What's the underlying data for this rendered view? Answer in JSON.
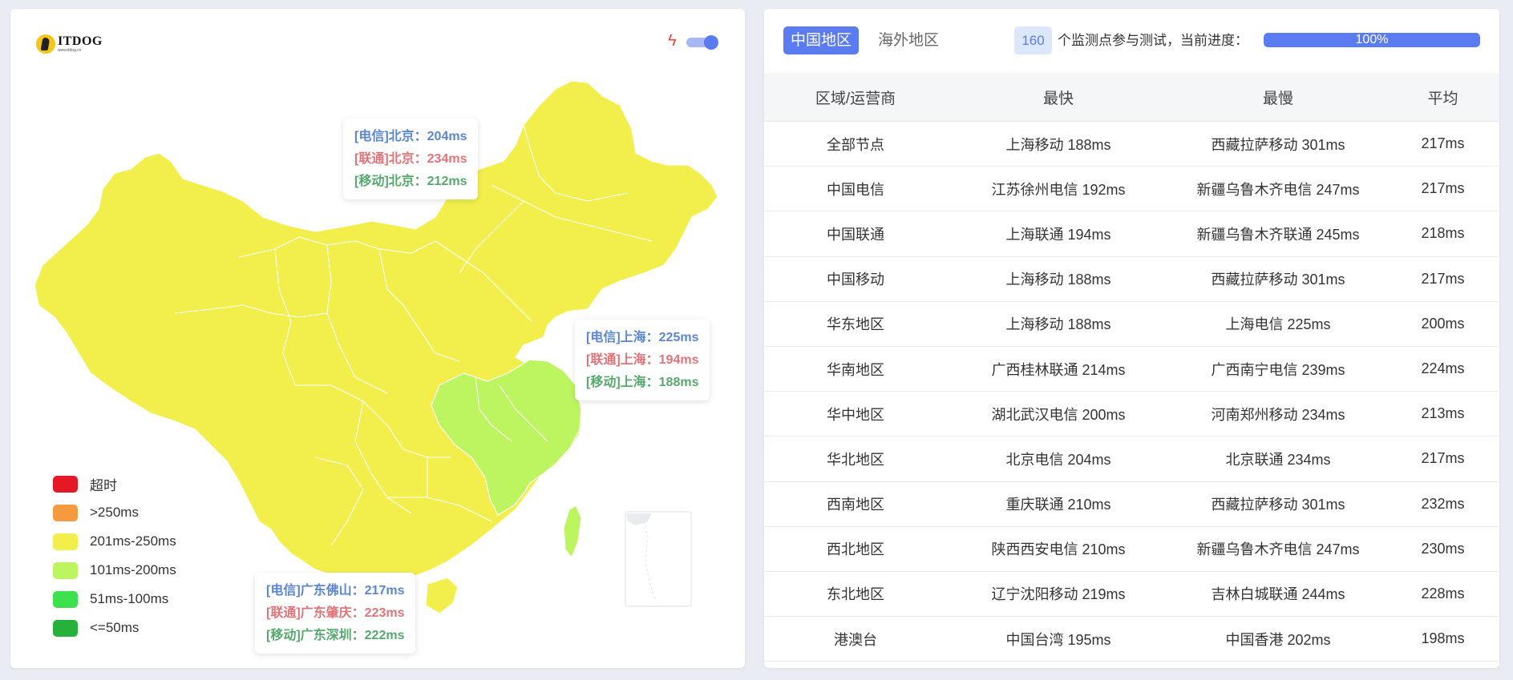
{
  "brand": {
    "title": "ITDOG",
    "subtitle": "www.itdog.cn"
  },
  "map": {
    "tooltips": {
      "beijing": [
        "[电信]北京：204ms",
        "[联通]北京：234ms",
        "[移动]北京：212ms"
      ],
      "shanghai": [
        "[电信]上海：225ms",
        "[联通]上海：194ms",
        "[移动]上海：188ms"
      ],
      "guangdong": [
        "[电信]广东佛山：217ms",
        "[联通]广东肇庆：223ms",
        "[移动]广东深圳：222ms"
      ]
    },
    "colors": {
      "range_201_250": "#f2ef4d",
      "range_101_200": "#bdf561"
    }
  },
  "legend": [
    {
      "label": "超时",
      "color": "#e51827"
    },
    {
      "label": ">250ms",
      "color": "#f49b3f"
    },
    {
      "label": "201ms-250ms",
      "color": "#f2ef4d"
    },
    {
      "label": "101ms-200ms",
      "color": "#bdf561"
    },
    {
      "label": "51ms-100ms",
      "color": "#3de04d"
    },
    {
      "label": "<=50ms",
      "color": "#26b13a"
    }
  ],
  "tabs": {
    "active": "中国地区",
    "inactive": "海外地区"
  },
  "status": {
    "count": "160",
    "text": "个监测点参与测试，当前进度：",
    "progress": "100%",
    "progress_fraction": 1.0
  },
  "table": {
    "headers": [
      "区域/运营商",
      "最快",
      "最慢",
      "平均"
    ],
    "rows": [
      [
        "全部节点",
        "上海移动 188ms",
        "西藏拉萨移动 301ms",
        "217ms"
      ],
      [
        "中国电信",
        "江苏徐州电信 192ms",
        "新疆乌鲁木齐电信 247ms",
        "217ms"
      ],
      [
        "中国联通",
        "上海联通 194ms",
        "新疆乌鲁木齐联通 245ms",
        "218ms"
      ],
      [
        "中国移动",
        "上海移动 188ms",
        "西藏拉萨移动 301ms",
        "217ms"
      ],
      [
        "华东地区",
        "上海移动 188ms",
        "上海电信 225ms",
        "200ms"
      ],
      [
        "华南地区",
        "广西桂林联通 214ms",
        "广西南宁电信 239ms",
        "224ms"
      ],
      [
        "华中地区",
        "湖北武汉电信 200ms",
        "河南郑州移动 234ms",
        "213ms"
      ],
      [
        "华北地区",
        "北京电信 204ms",
        "北京联通 234ms",
        "217ms"
      ],
      [
        "西南地区",
        "重庆联通 210ms",
        "西藏拉萨移动 301ms",
        "232ms"
      ],
      [
        "西北地区",
        "陕西西安电信 210ms",
        "新疆乌鲁木齐电信 247ms",
        "230ms"
      ],
      [
        "东北地区",
        "辽宁沈阳移动 219ms",
        "吉林白城联通 244ms",
        "228ms"
      ],
      [
        "港澳台",
        "中国台湾 195ms",
        "中国香港 202ms",
        "198ms"
      ]
    ]
  }
}
